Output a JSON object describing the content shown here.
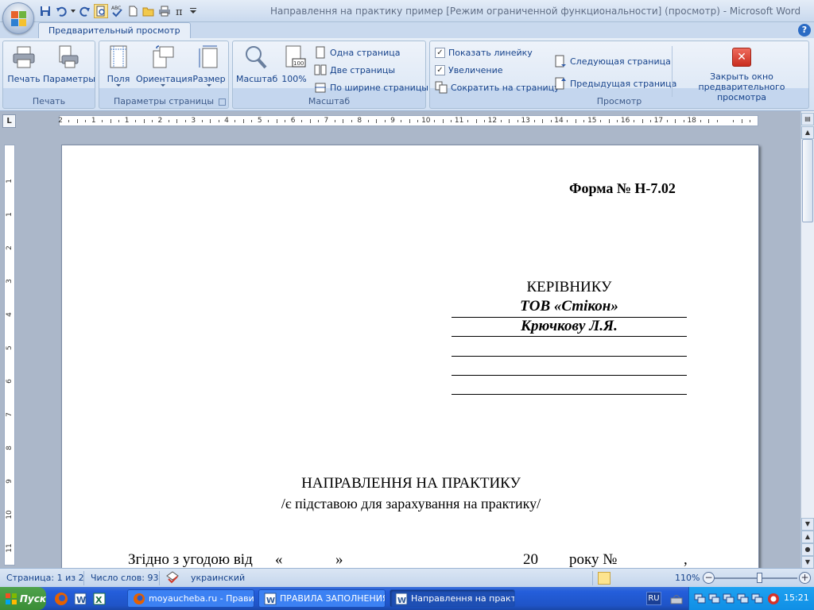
{
  "window": {
    "title": "Направлення на практику пример [Режим ограниченной функциональности] (просмотр) - Microsoft Word"
  },
  "ribbon": {
    "active_tab": "Предварительный просмотр",
    "groups": {
      "print": {
        "label": "Печать",
        "print_label": "Печать",
        "options_label": "Параметры"
      },
      "page_setup": {
        "label": "Параметры страницы",
        "margins_label": "Поля",
        "orientation_label": "Ориентация",
        "size_label": "Размер"
      },
      "zoom": {
        "label": "Масштаб",
        "zoom_label": "Масштаб",
        "hundred_label": "100%",
        "one_page_label": "Одна страница",
        "two_pages_label": "Две страницы",
        "page_width_label": "По ширине страницы"
      },
      "preview": {
        "label": "Просмотр",
        "show_ruler_label": "Показать линейку",
        "magnifier_label": "Увеличение",
        "shrink_label": "Сократить на страницу",
        "next_page_label": "Следующая страница",
        "prev_page_label": "Предыдущая страница",
        "close_label_1": "Закрыть окно",
        "close_label_2": "предварительного просмотра"
      }
    }
  },
  "ruler": {
    "corner": "L",
    "h_numbers": [
      "2",
      "1",
      "1",
      "2",
      "3",
      "4",
      "5",
      "6",
      "7",
      "8",
      "9",
      "10",
      "11",
      "12",
      "13",
      "14",
      "15",
      "16",
      "17",
      "18"
    ],
    "v_numbers": [
      "1",
      "1",
      "2",
      "3",
      "4",
      "5",
      "6",
      "7",
      "8",
      "9",
      "10",
      "11"
    ]
  },
  "document": {
    "form_number": "Форма № Н-7.02",
    "recipient_title": "КЕРІВНИКУ",
    "company": "ТОВ «Стікон»",
    "person": "Крючкову Л.Я.",
    "heading": "НАПРАВЛЕННЯ НА ПРАКТИКУ",
    "subheading": "/є підставою для зарахування на практику/",
    "agreement_line_start": "Згідно з угодою від",
    "quote_open": "«",
    "quote_close": "»",
    "year_prefix": "20",
    "year_suffix": "року №",
    "line_end": ","
  },
  "status": {
    "page": "Страница: 1 из 2",
    "words": "Число слов: 93",
    "language": "украинский",
    "zoom": "110%",
    "zoom_fraction": 0.55
  },
  "taskbar": {
    "start_label": "Пуск",
    "tasks": [
      {
        "label": "moyaucheba.ru - Прави..."
      },
      {
        "label": "ПРАВИЛА ЗАПОЛНЕНИЯ..."
      },
      {
        "label": "Направлення на практ..."
      }
    ],
    "lang": "RU",
    "clock": "15:21"
  },
  "colors": {
    "accent": "#15428b",
    "ribbon_bg": "#dfe9f6",
    "doc_bg": "#abb7c9",
    "close_button": "#d9332a",
    "taskbar": "#245edb"
  }
}
